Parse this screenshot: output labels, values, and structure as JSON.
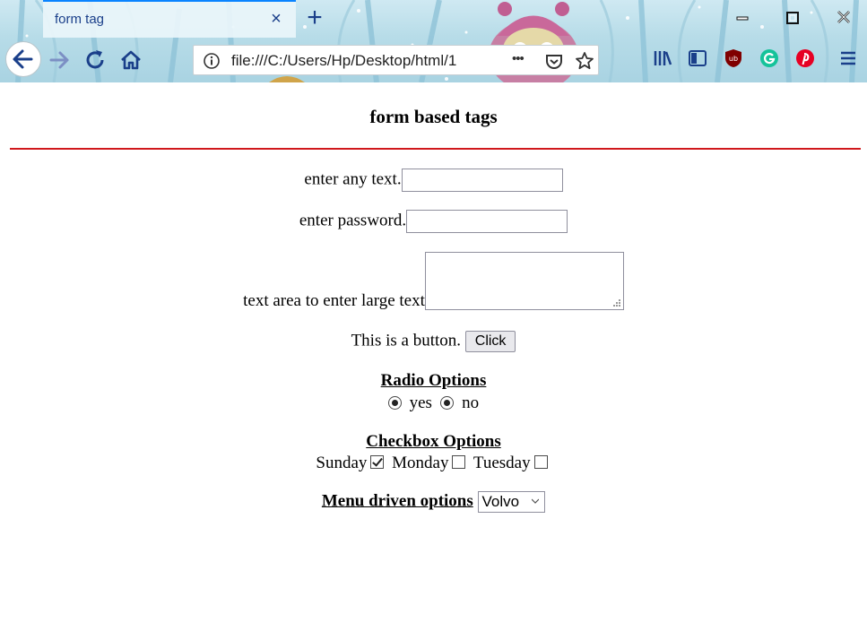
{
  "browser": {
    "tab_title": "form tag",
    "tab_close": "×",
    "new_tab": "+",
    "url": "file:///C:/Users/Hp/Desktop/html/1",
    "page_actions": "•••"
  },
  "page": {
    "heading": "form based tags",
    "text_label": "enter any text.",
    "password_label": "enter password.",
    "textarea_label": "text area to enter large text",
    "button_label": "This is a button.",
    "button_text": "Click",
    "radio_heading": "Radio Options",
    "radio_yes": "yes",
    "radio_no": "no",
    "checkbox_heading": "Checkbox Options",
    "checkbox_sunday": "Sunday",
    "checkbox_monday": "Monday",
    "checkbox_tuesday": "Tuesday",
    "menu_heading": "Menu driven options",
    "menu_selected": "Volvo"
  },
  "colors": {
    "rule": "#d0181c",
    "accent": "#0a84ff",
    "chrome_icon": "#1a3f8a"
  }
}
